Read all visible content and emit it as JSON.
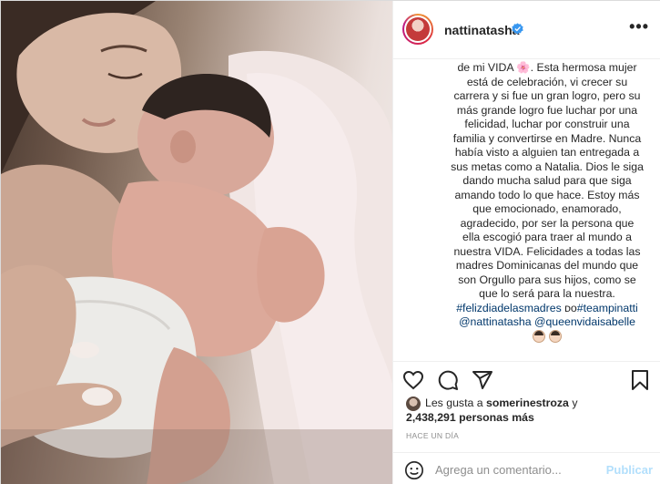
{
  "post": {
    "username": "nattinatasha",
    "caption_lines": [
      "de mi VIDA 🌸. Esta hermosa mujer",
      "está de celebración, vi crecer su",
      "carrera y si fue un gran logro, pero su",
      "más grande logro fue luchar por una",
      "felicidad, luchar por construir una",
      "familia y convertirse en Madre. Nunca",
      "había visto a alguien tan entregada a",
      "sus metas como a Natalia. Dios le siga",
      "dando mucha salud para que siga",
      "amando todo lo que hace. Estoy más",
      "que emocionado, enamorado,",
      "agradecido, por ser la persona que",
      "ella escogió para traer al mundo a",
      "nuestra VIDA. Felicidades a todas las",
      "madres Dominicanas del mundo que",
      "son Orgullo para sus hijos, como se",
      "que lo será para la nuestra."
    ],
    "hashtags_line1_a": "#felizdiadelasmadres",
    "hashtags_line1_b": "#teampinatti",
    "hashtags_line1_prefix": " ᴅᴏ",
    "mentions_line": "@nattinatasha @queenvidaisabelle",
    "likes_prefix": "Les gusta a ",
    "likes_user": "somerinestroza",
    "likes_suffix": " y",
    "likes_count_line": "2,438,291 personas más",
    "timestamp": "HACE UN DÍA",
    "comment_placeholder": "Agrega un comentario...",
    "publish_label": "Publicar",
    "more_glyph": "•••"
  },
  "icons": {
    "like": "heart-icon",
    "comment": "comment-icon",
    "share": "share-icon",
    "save": "bookmark-icon",
    "emoji": "emoji-icon",
    "verified": "verified-badge-icon"
  },
  "colors": {
    "link": "#00376b",
    "verified": "#3897f0",
    "publish_disabled": "#b2dffc"
  }
}
